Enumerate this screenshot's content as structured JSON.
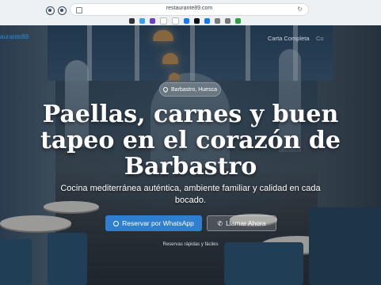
{
  "browser": {
    "url": "restaurante89.com",
    "extensions": [
      {
        "icon": "ext-dot-icon",
        "color": "#333"
      },
      {
        "icon": "ext-cloud-icon",
        "color": "#3aa0e8"
      },
      {
        "icon": "ext-check-icon",
        "color": "#6a3fc9"
      },
      {
        "icon": "ext-g-icon",
        "color": "#ffffff"
      },
      {
        "icon": "ext-g2-icon",
        "color": "#ffffff"
      },
      {
        "icon": "ext-f-icon",
        "color": "#1877f2"
      },
      {
        "icon": "ext-x-icon",
        "color": "#111"
      },
      {
        "icon": "ext-f2-icon",
        "color": "#1877f2"
      },
      {
        "icon": "ext-ig-icon",
        "color": "#7a7a7a"
      },
      {
        "icon": "ext-globe-icon",
        "color": "#777"
      },
      {
        "icon": "ext-green-icon",
        "color": "#2ea043"
      }
    ]
  },
  "nav": {
    "brand": "aurante89",
    "links": [
      "Carta Completa",
      "Co"
    ]
  },
  "hero": {
    "location": "Barbastro, Huesca",
    "title": "Paellas, carnes y buen tapeo en el corazón de Barbastro",
    "subtitle": "Cocina mediterránea auténtica, ambiente familiar y calidad en cada bocado.",
    "cta_primary": "Reservar por WhatsApp",
    "cta_secondary": "Llamar Ahora",
    "caption": "Reservas rápidas y fáciles"
  },
  "colors": {
    "accent": "#2f7fd1",
    "brand": "#2a8bd8"
  }
}
